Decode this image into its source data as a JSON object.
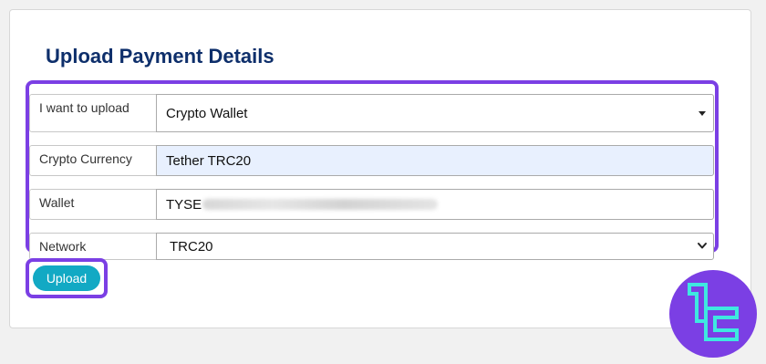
{
  "page": {
    "title": "Upload Payment Details"
  },
  "form": {
    "upload_type": {
      "label": "I want to upload",
      "value": "Crypto Wallet"
    },
    "crypto_currency": {
      "label": "Crypto Currency",
      "value": "Tether TRC20"
    },
    "wallet": {
      "label": "Wallet",
      "value_prefix": "TYSE"
    },
    "network": {
      "label": "Network",
      "value": "TRC20"
    }
  },
  "actions": {
    "upload_label": "Upload"
  },
  "colors": {
    "title": "#0e2f6b",
    "highlight": "#7b3fe4",
    "button": "#12a9c4",
    "autofill": "#e8f0fe",
    "logo_bg": "#7b3fe4",
    "logo_mark": "#3ee8e0"
  },
  "icons": {
    "dropdown_caret": "caret-down-icon",
    "select_chevron": "chevron-down-icon",
    "brand_logo": "brand-logo-icon"
  }
}
